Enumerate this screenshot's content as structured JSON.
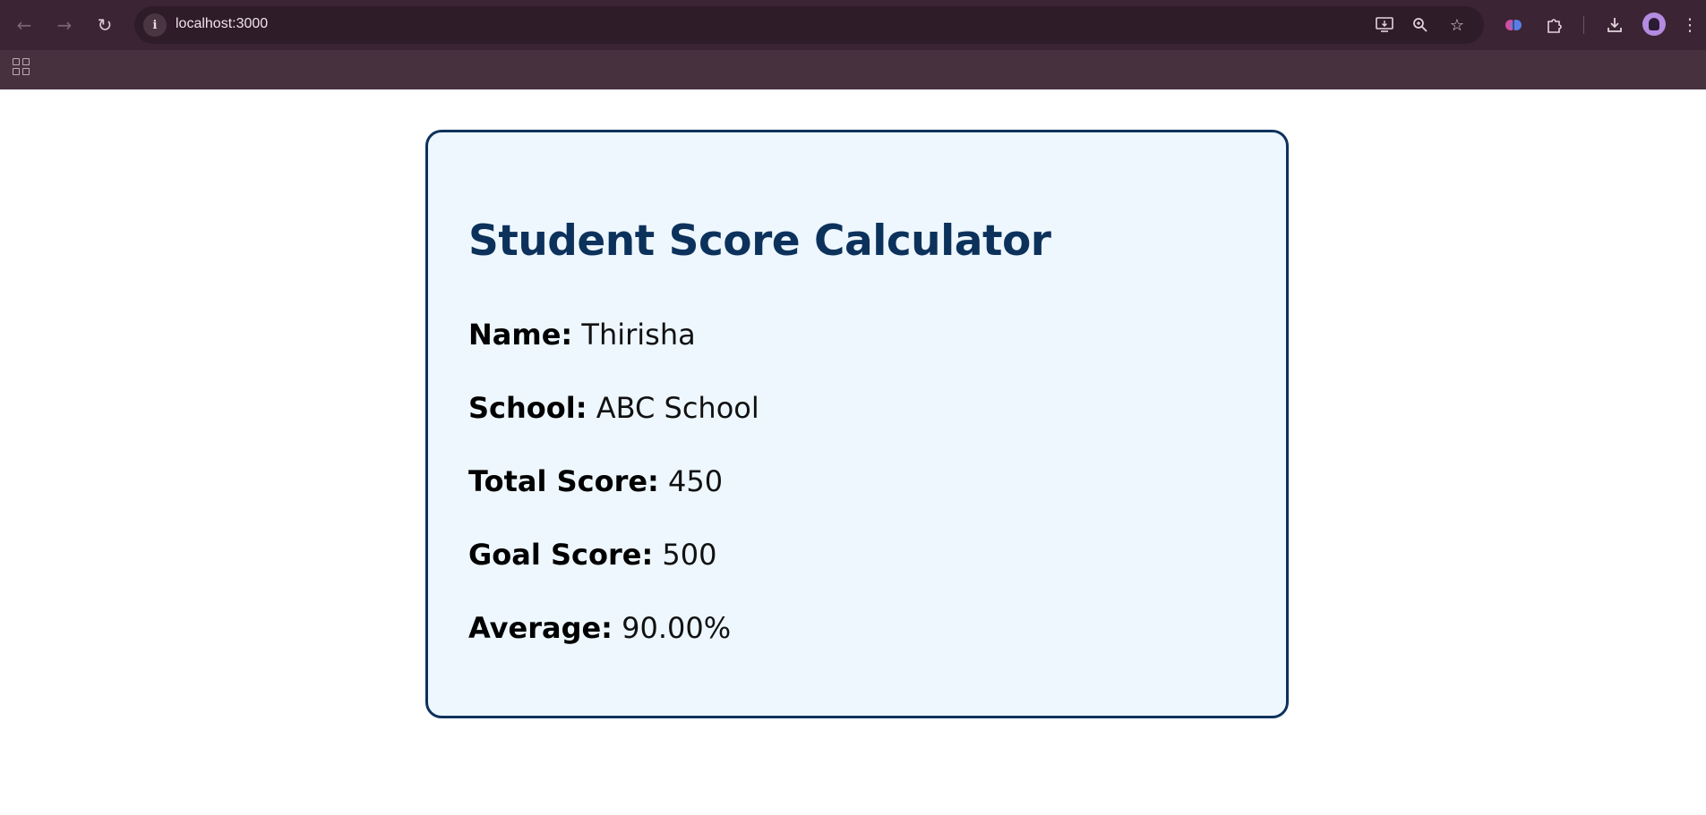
{
  "browser": {
    "url": "localhost:3000",
    "site_info_glyph": "i",
    "icons": {
      "back": "arrow-left-icon",
      "forward": "arrow-right-icon",
      "reload": "reload-icon",
      "install": "install-app-icon",
      "zoom": "zoom-icon",
      "bookmark": "star-icon",
      "extension_brain": "brain-extension-icon",
      "extensions": "puzzle-icon",
      "downloads": "download-icon",
      "menu": "kebab-menu-icon",
      "apps": "apps-grid-icon"
    }
  },
  "card": {
    "title": "Student Score Calculator",
    "name_label": "Name:",
    "name_value": "Thirisha",
    "school_label": "School:",
    "school_value": "ABC School",
    "total_label": "Total Score:",
    "total_value": "450",
    "goal_label": "Goal Score:",
    "goal_value": "500",
    "average_label": "Average:",
    "average_value": "90.00%"
  },
  "colors": {
    "chrome_top": "#3b2433",
    "chrome_bar": "#47313f",
    "card_border": "#0c325c",
    "card_background": "#eef7fe",
    "title_color": "#0c325c"
  }
}
